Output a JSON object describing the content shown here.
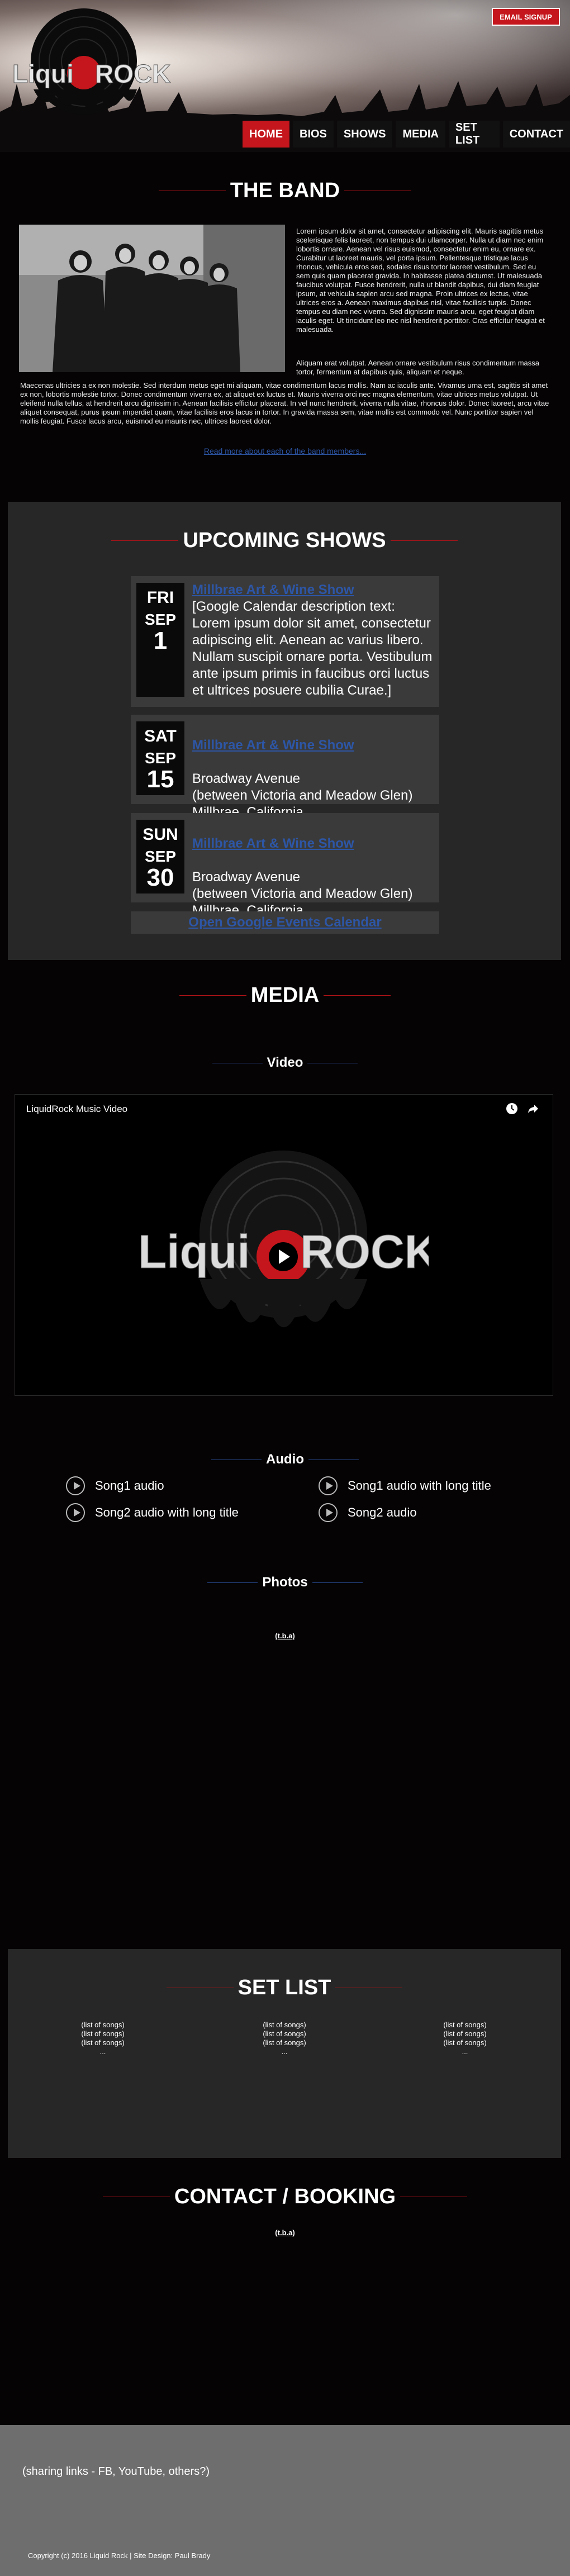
{
  "header": {
    "logo_text_left": "Liqui",
    "logo_text_right": "ROCK",
    "email_signup": "EMAIL SIGNUP",
    "nav": [
      "HOME",
      "BIOS",
      "SHOWS",
      "MEDIA",
      "SET LIST",
      "CONTACT"
    ],
    "active_nav": "HOME"
  },
  "band": {
    "title": "THE BAND",
    "paragraph1": "Lorem ipsum dolor sit amet, consectetur adipiscing elit. Mauris sagittis metus scelerisque felis laoreet, non tempus dui ullamcorper. Nulla ut diam nec enim lobortis ornare. Aenean vel risus euismod, consectetur enim eu, ornare ex. Curabitur ut laoreet mauris, vel porta ipsum. Pellentesque tristique lacus rhoncus, vehicula eros sed, sodales risus tortor laoreet vestibulum. Sed eu sem quis quam placerat gravida. In habitasse platea dictumst. Ut malesuada faucibus volutpat. Fusce hendrerit, nulla ut blandit dapibus, dui diam feugiat ipsum, at vehicula sapien arcu sed magna. Proin ultrices ex lectus, vitae ultrices eros a. Aenean maximus dapibus nisl, vitae facilisis turpis. Donec tempus eu diam nec viverra. Sed dignissim mauris arcu, eget feugiat diam iaculis eget. Ut tincidunt leo nec nisl hendrerit porttitor. Cras efficitur feugiat et malesuada.",
    "paragraph2": "Aliquam erat volutpat. Aenean ornare vestibulum risus condimentum massa tortor, fermentum at dapibus quis, aliquam et neque.",
    "paragraph3": "Maecenas ultricies a ex non molestie. Sed interdum metus eget mi aliquam, vitae condimentum lacus mollis. Nam ac iaculis ante. Vivamus urna est, sagittis sit amet ex non, lobortis molestie tortor. Donec condimentum viverra ex, at aliquet ex luctus et. Mauris viverra orci nec magna elementum, vitae ultrices metus volutpat. Ut eleifend nulla tellus, at hendrerit arcu dignissim in. Aenean facilisis efficitur placerat. In vel nunc hendrerit, viverra nulla vitae, rhoncus dolor. Donec laoreet, arcu vitae aliquet consequat, purus ipsum imperdiet quam, vitae facilisis eros lacus in tortor. In gravida massa sem, vitae mollis est commodo vel. Nunc porttitor sapien vel mollis feugiat. Fusce lacus arcu, euismod eu mauris nec, ultrices laoreet dolor.",
    "more_link": "Read more about each of the band members..."
  },
  "shows": {
    "title": "UPCOMING SHOWS",
    "items": [
      {
        "dow": "FRI",
        "month": "SEP",
        "day": "1",
        "title": "Millbrae Art & Wine Show",
        "detail": "[Google Calendar description text: Lorem ipsum dolor sit amet, consectetur adipiscing elit. Aenean ac varius libero. Nullam suscipit ornare porta. Vestibulum ante ipsum primis in faucibus orci luctus et ultrices posuere cubilia Curae.]"
      },
      {
        "dow": "SAT",
        "month": "SEP",
        "day": "15",
        "title": "Millbrae Art & Wine Show",
        "detail": "Broadway Avenue\n(between Victoria and Meadow Glen)\nMillbrae, California"
      },
      {
        "dow": "SUN",
        "month": "SEP",
        "day": "30",
        "title": "Millbrae Art & Wine Show",
        "detail": "Broadway Avenue\n(between Victoria and Meadow Glen)\nMillbrae, California"
      }
    ],
    "calendar_link": "Open Google Events Calendar"
  },
  "media": {
    "title": "MEDIA",
    "video_title": "Video",
    "video_label": "LiquidRock Music Video",
    "audio_title": "Audio",
    "audio": [
      "Song1 audio",
      "Song2 audio with long title",
      "Song1 audio with long title",
      "Song2 audio"
    ],
    "photos_title": "Photos",
    "photos_tba": "(t.b.a)"
  },
  "setlist": {
    "title": "SET LIST",
    "columns": [
      [
        "(list of songs)",
        "(list of songs)",
        "(list of songs)",
        "..."
      ],
      [
        "(list of songs)",
        "(list of songs)",
        "(list of songs)",
        "..."
      ],
      [
        "(list of songs)",
        "(list of songs)",
        "(list of songs)",
        "..."
      ]
    ]
  },
  "contact": {
    "title": "CONTACT / BOOKING",
    "tba": "(t.b.a)"
  },
  "footer": {
    "share": "(sharing links - FB, YouTube, others?)",
    "copyright": "Copyright (c) 2016 Liquid Rock | Site Design: Paul Brady"
  },
  "colors": {
    "accent_red": "#c4161c",
    "link_blue": "#2d56a6",
    "panel_gray": "#272727"
  }
}
